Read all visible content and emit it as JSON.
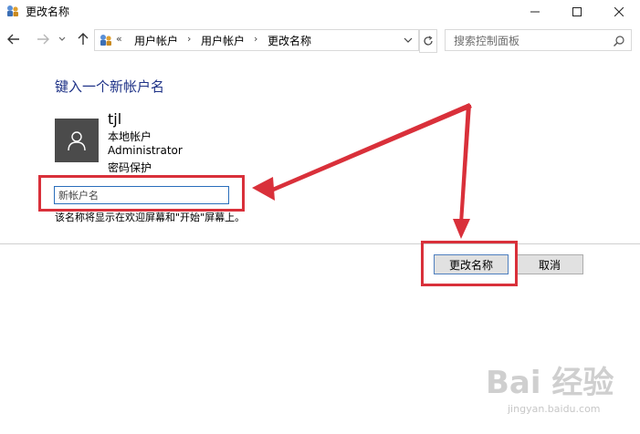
{
  "window": {
    "title": "更改名称",
    "controls": [
      "minimize",
      "maximize",
      "close"
    ]
  },
  "nav": {
    "breadcrumb_prefix": "«",
    "breadcrumbs": [
      "用户帐户",
      "用户帐户",
      "更改名称"
    ],
    "search_placeholder": "搜索控制面板"
  },
  "content": {
    "heading": "键入一个新帐户名",
    "user": {
      "name": "tjl",
      "details": [
        "本地帐户",
        "Administrator",
        "密码保护"
      ]
    },
    "new_name_placeholder": "新帐户名",
    "hint": "该名称将显示在欢迎屏幕和\"开始\"屏幕上。"
  },
  "buttons": {
    "rename": "更改名称",
    "cancel": "取消"
  },
  "watermark": {
    "brand": "Bai 经验",
    "url": "jingyan.baidu.com"
  },
  "colors": {
    "heading": "#1e3287",
    "annotation": "#d9303a",
    "avatar_bg": "#4b4b4b",
    "input_border": "#2a6ebb"
  },
  "icons": [
    "control-panel-icon",
    "back-arrow-icon",
    "forward-arrow-icon",
    "recent-dropdown-icon",
    "up-arrow-icon",
    "refresh-icon",
    "search-icon",
    "user-avatar-icon"
  ]
}
